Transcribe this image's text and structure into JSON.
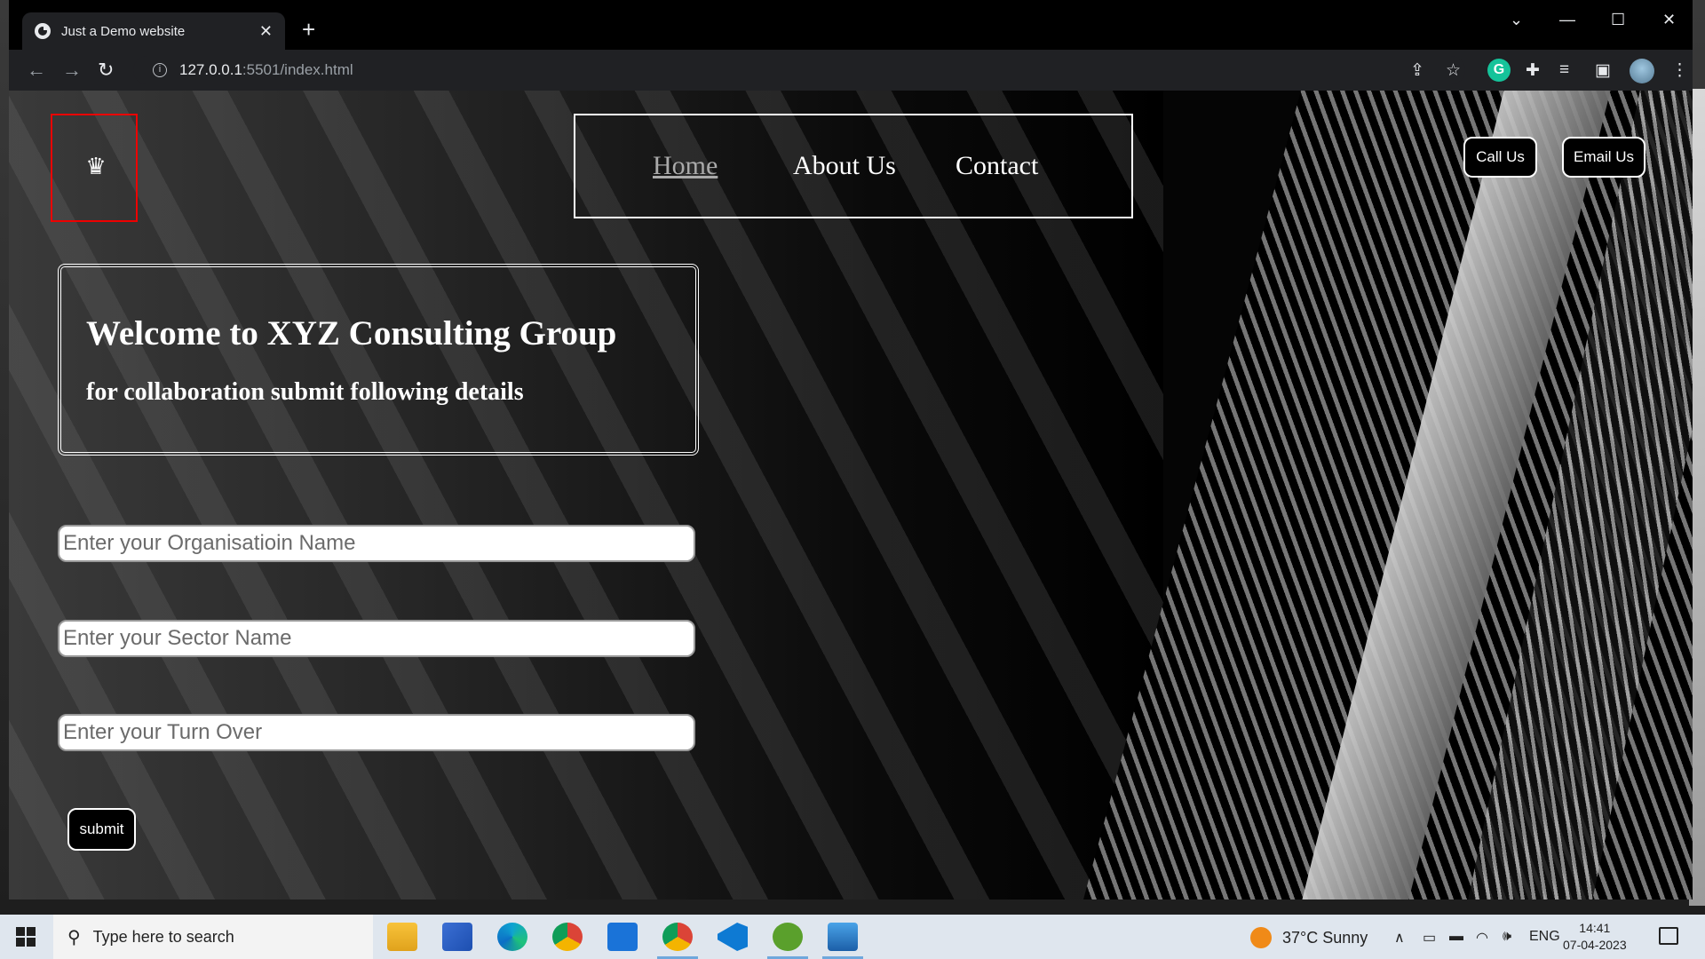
{
  "browser": {
    "tab_title": "Just a Demo website",
    "tab_close": "✕",
    "new_tab": "+",
    "url_host": "127.0.0.1",
    "url_path": ":5501/index.html",
    "window_controls": {
      "dropdown": "⌄",
      "minimize": "—",
      "maximize": "☐",
      "close": "✕"
    }
  },
  "page": {
    "nav": {
      "home": "Home",
      "about": "About Us",
      "contact": "Contact"
    },
    "actions": {
      "call": "Call Us",
      "email": "Email Us"
    },
    "welcome": {
      "heading": "Welcome to XYZ Consulting Group",
      "subheading": "for collaboration submit following details"
    },
    "form": {
      "org_placeholder": "Enter your Organisatioin Name",
      "sector_placeholder": "Enter your Sector Name",
      "turnover_placeholder": "Enter your Turn Over",
      "submit_label": "submit"
    }
  },
  "taskbar": {
    "search_placeholder": "Type here to search",
    "weather": "37°C  Sunny",
    "language": "ENG",
    "time": "14:41",
    "date": "07-04-2023"
  },
  "colors": {
    "logo_border": "#ee0000",
    "grammarly": "#15c39a",
    "weather_sun": "#f08a18",
    "vscode": "#0e7ad3",
    "utorrent": "#5aa02c"
  }
}
